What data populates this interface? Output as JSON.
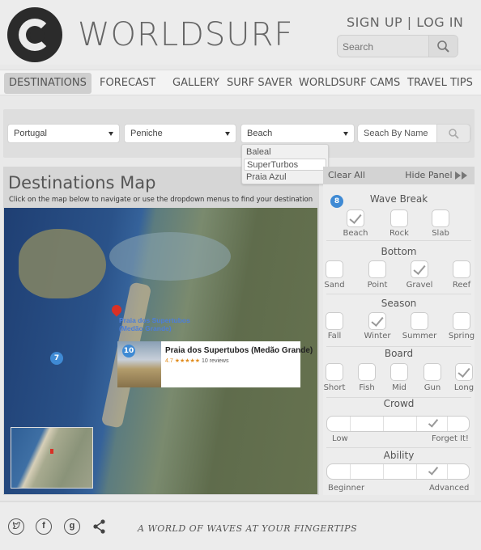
{
  "header": {
    "brand": "WORLDSURF",
    "sign_up": "SIGN UP",
    "separator": "|",
    "log_in": "LOG IN",
    "search_placeholder": "Search"
  },
  "nav": {
    "items": [
      {
        "label": "DESTINATIONS",
        "active": true
      },
      {
        "label": "FORECAST"
      },
      {
        "label": "GALLERY"
      },
      {
        "label": "SURF SAVER"
      },
      {
        "label": "WORLDSURF CAMS"
      },
      {
        "label": "TRAVEL TIPS"
      }
    ]
  },
  "filters": {
    "country": "Portugal",
    "region": "Peniche",
    "type": "Beach",
    "search_by_name": "Seach By Name",
    "dropdown_options": [
      "Baleal",
      "SuperTurbos",
      "Praia Azul"
    ],
    "highlighted_option": "SuperTurbos"
  },
  "map_panel": {
    "title": "Destinations Map",
    "subtitle": "Click on the map below to navigate or use the dropdown menus to find your destination",
    "badge_map": "7",
    "pin_label_line1": "Praia dos Supertubos",
    "pin_label_line2": "(Medão Grande)",
    "card": {
      "badge": "10",
      "name": "Praia dos Supertubos (Medão Grande)",
      "rating": "4.7",
      "stars": "★★★★★",
      "reviews": "10 reviews"
    }
  },
  "right_panel": {
    "clear_all": "Clear All",
    "hide_panel": "Hide Panel",
    "badge": "8",
    "wave_break": {
      "title": "Wave Break",
      "options": [
        "Beach",
        "Rock",
        "Slab"
      ],
      "checked": [
        "Beach"
      ]
    },
    "bottom": {
      "title": "Bottom",
      "options": [
        "Sand",
        "Point",
        "Gravel",
        "Reef"
      ],
      "checked": [
        "Gravel"
      ]
    },
    "season": {
      "title": "Season",
      "options": [
        "Fall",
        "Winter",
        "Summer",
        "Spring"
      ],
      "checked": [
        "Winter"
      ]
    },
    "board": {
      "title": "Board",
      "options": [
        "Short",
        "Fish",
        "Mid",
        "Gun",
        "Long"
      ],
      "checked": [
        "Long"
      ]
    },
    "crowd": {
      "title": "Crowd",
      "low": "Low",
      "high": "Forget It!",
      "level": 0.75
    },
    "ability": {
      "title": "Ability",
      "low": "Beginner",
      "high": "Advanced",
      "level": 0.75
    }
  },
  "footer": {
    "tagline": "A WORLD OF WAVES AT YOUR FINGERTIPS",
    "icons": [
      "twitter-icon",
      "facebook-icon",
      "google-plus-icon",
      "share-icon"
    ]
  }
}
